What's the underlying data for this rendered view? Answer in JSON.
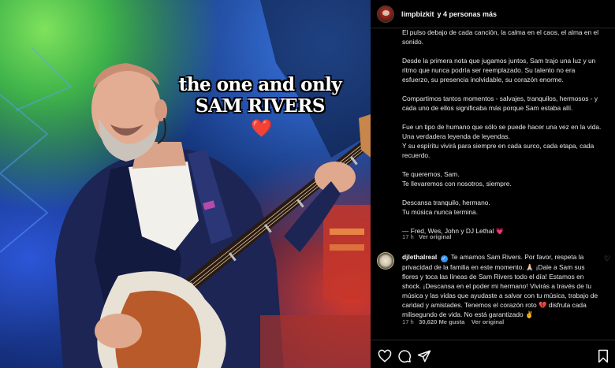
{
  "photo": {
    "overlay_line1": "the one and only",
    "overlay_line2": "SAM RIVERS",
    "heart": "❤️"
  },
  "header": {
    "username": "limpbizkit",
    "coauthors": "y 4 personas más"
  },
  "caption": {
    "paragraphs": [
      "El pulso debajo de cada canción, la calma en el caos, el alma en el sonido.",
      "Desde la primera nota que jugamos juntos, Sam trajo una luz y un ritmo que nunca podría ser reemplazado. Su talento no era esfuerzo, su presencia inolvidable, su corazón enorme.",
      "Compartimos tantos momentos - salvajes, tranquilos, hermosos - y cada uno de ellos significaba más porque Sam estaba allí.",
      "Fue un tipo de humano que sólo se puede hacer una vez en la vida.",
      "Una verdadera leyenda de leyendas.",
      "Y su espíritu vivirá para siempre en cada surco, cada etapa, cada recuerdo.",
      "Te queremos, Sam.",
      "Te llevaremos con nosotros, siempre.",
      "Descansa tranquilo, hermano.",
      "Tu música nunca termina.",
      "— Fred, Wes, John y DJ Lethal 💗"
    ],
    "time": "17 h",
    "translate": "Ver original"
  },
  "comment": {
    "username": "djlethalreal",
    "verified_glyph": "✓",
    "text": "Te amamos Sam Rivers. Por favor, respeta la privacidad de la familia en este momento. 🙏🏻 ¡Dale a Sam sus flores y toca las líneas de Sam Rivers todo el día! Estamos en shock. ¡Descansa en el poder mi hermano! Vivirás a través de tu música y las vidas que ayudaste a salvar con tu música, trabajo de caridad y amistades. Tenemos el corazón roto 💔 disfruta cada milisegundo de vida. No está garantizado ✌️",
    "time": "17 h",
    "likes": "30,620 Me gusta",
    "translate": "Ver original",
    "like_icon": "♡"
  },
  "actions": {
    "icons": [
      "heart-outline-icon",
      "comment-icon",
      "share-icon",
      "bookmark-icon"
    ]
  },
  "colors": {
    "background": "#000000",
    "text": "#f5f5f5",
    "muted": "#a8a8a8",
    "verified": "#3797f0",
    "heart": "#e8262e"
  }
}
